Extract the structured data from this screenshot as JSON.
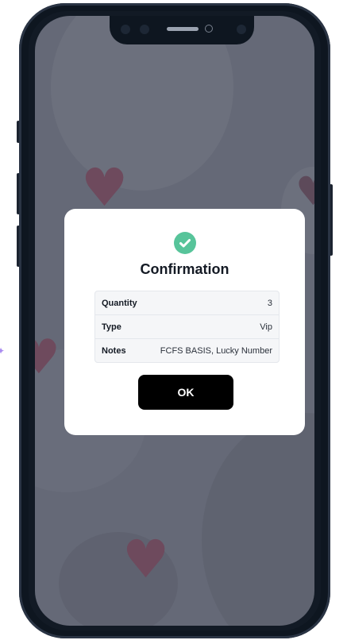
{
  "dialog": {
    "icon": "check-circle-icon",
    "title": "Confirmation",
    "rows": [
      {
        "label": "Quantity",
        "value": "3"
      },
      {
        "label": "Type",
        "value": "Vip"
      },
      {
        "label": "Notes",
        "value": "FCFS BASIS, Lucky Number"
      }
    ],
    "ok_label": "OK"
  },
  "colors": {
    "accent_check": "#57c49a",
    "button_bg": "#000000",
    "overlay": "#656977",
    "heart": "#6e4a5d"
  }
}
